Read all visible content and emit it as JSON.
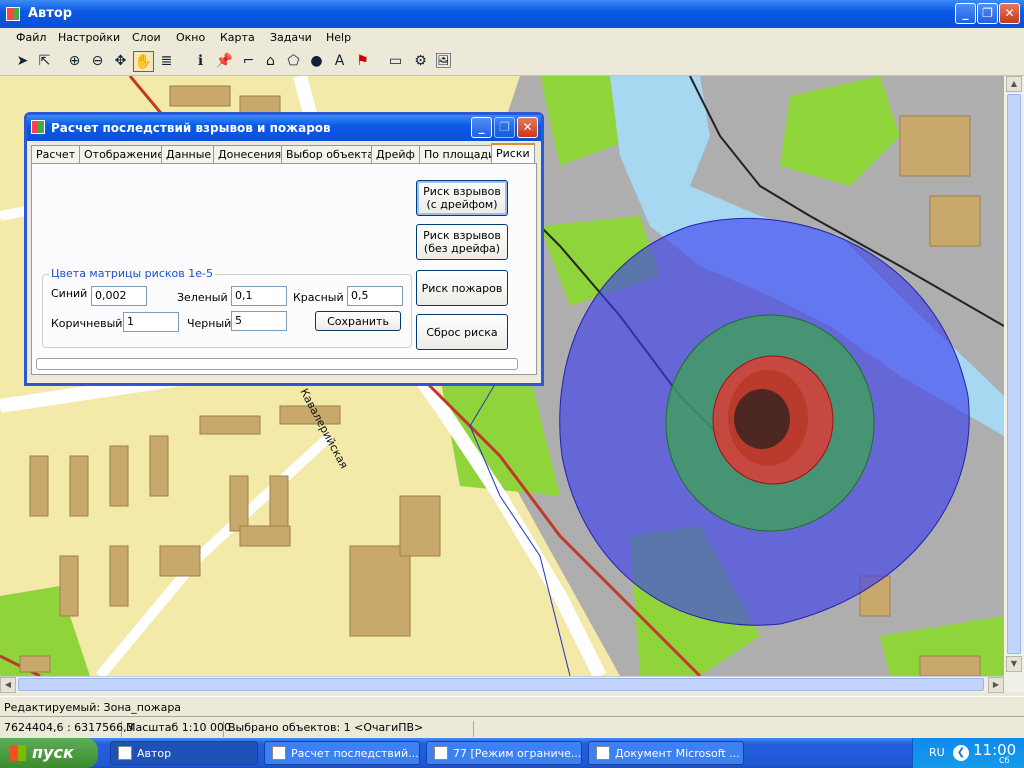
{
  "window": {
    "title": "Автор"
  },
  "menu": [
    "Файл",
    "Настройки",
    "Слои",
    "Окно",
    "Карта",
    "Задачи",
    "Help"
  ],
  "toolbar_icons": [
    "arrow-select-icon",
    "node-select-icon",
    "zoom-in-icon",
    "zoom-out-icon",
    "pan-all-icon",
    "hand-pan-icon",
    "layers-icon",
    "info-icon",
    "pin-icon",
    "polyline-icon",
    "polygon-icon",
    "region-icon",
    "ellipse-icon",
    "text-icon",
    "flag-icon",
    "ruler-icon",
    "tools-icon",
    "image-icon"
  ],
  "map": {
    "street_label": "Кавалерийская"
  },
  "dialog": {
    "title": "Расчет последствий взрывов и пожаров",
    "tabs": [
      "Расчет",
      "Отображение",
      "Данные",
      "Донесения",
      "Выбор объекта",
      "Дрейф",
      "По площади",
      "Риски"
    ],
    "selected_tab": "Риски",
    "buttons": {
      "explosion_drift": "Риск взрывов\n(с дрейфом)",
      "explosion_nodrift": "Риск взрывов\n(без дрейфа)",
      "fire": "Риск пожаров",
      "reset": "Сброс риска",
      "save": "Сохранить"
    },
    "group_caption": "Цвета матрицы рисков 1е-5",
    "fields": {
      "blue": {
        "label": "Синий",
        "value": "0,002"
      },
      "green": {
        "label": "Зеленый",
        "value": "0,1"
      },
      "red": {
        "label": "Красный",
        "value": "0,5"
      },
      "brown": {
        "label": "Коричневый",
        "value": "1"
      },
      "black": {
        "label": "Черный",
        "value": "5"
      }
    }
  },
  "edit_status": "Редактируемый: Зона_пожара",
  "status": {
    "coords": "7624404,6 : 6317566,3",
    "scale": "Масштаб 1:10 000",
    "selected": "Выбрано объектов: 1 <ОчагиПВ>"
  },
  "taskbar": {
    "start": "пуск",
    "tasks": [
      "Автор",
      "Расчет последствий...",
      "77 [Режим ограниче...",
      "Документ Microsoft ..."
    ],
    "lang": "RU",
    "time": "11:00",
    "day": "Сб"
  },
  "colors": {
    "risk_blue": "#3a3cf0",
    "risk_green": "#3aa84a",
    "risk_red": "#f03030",
    "risk_black": "#202020"
  }
}
